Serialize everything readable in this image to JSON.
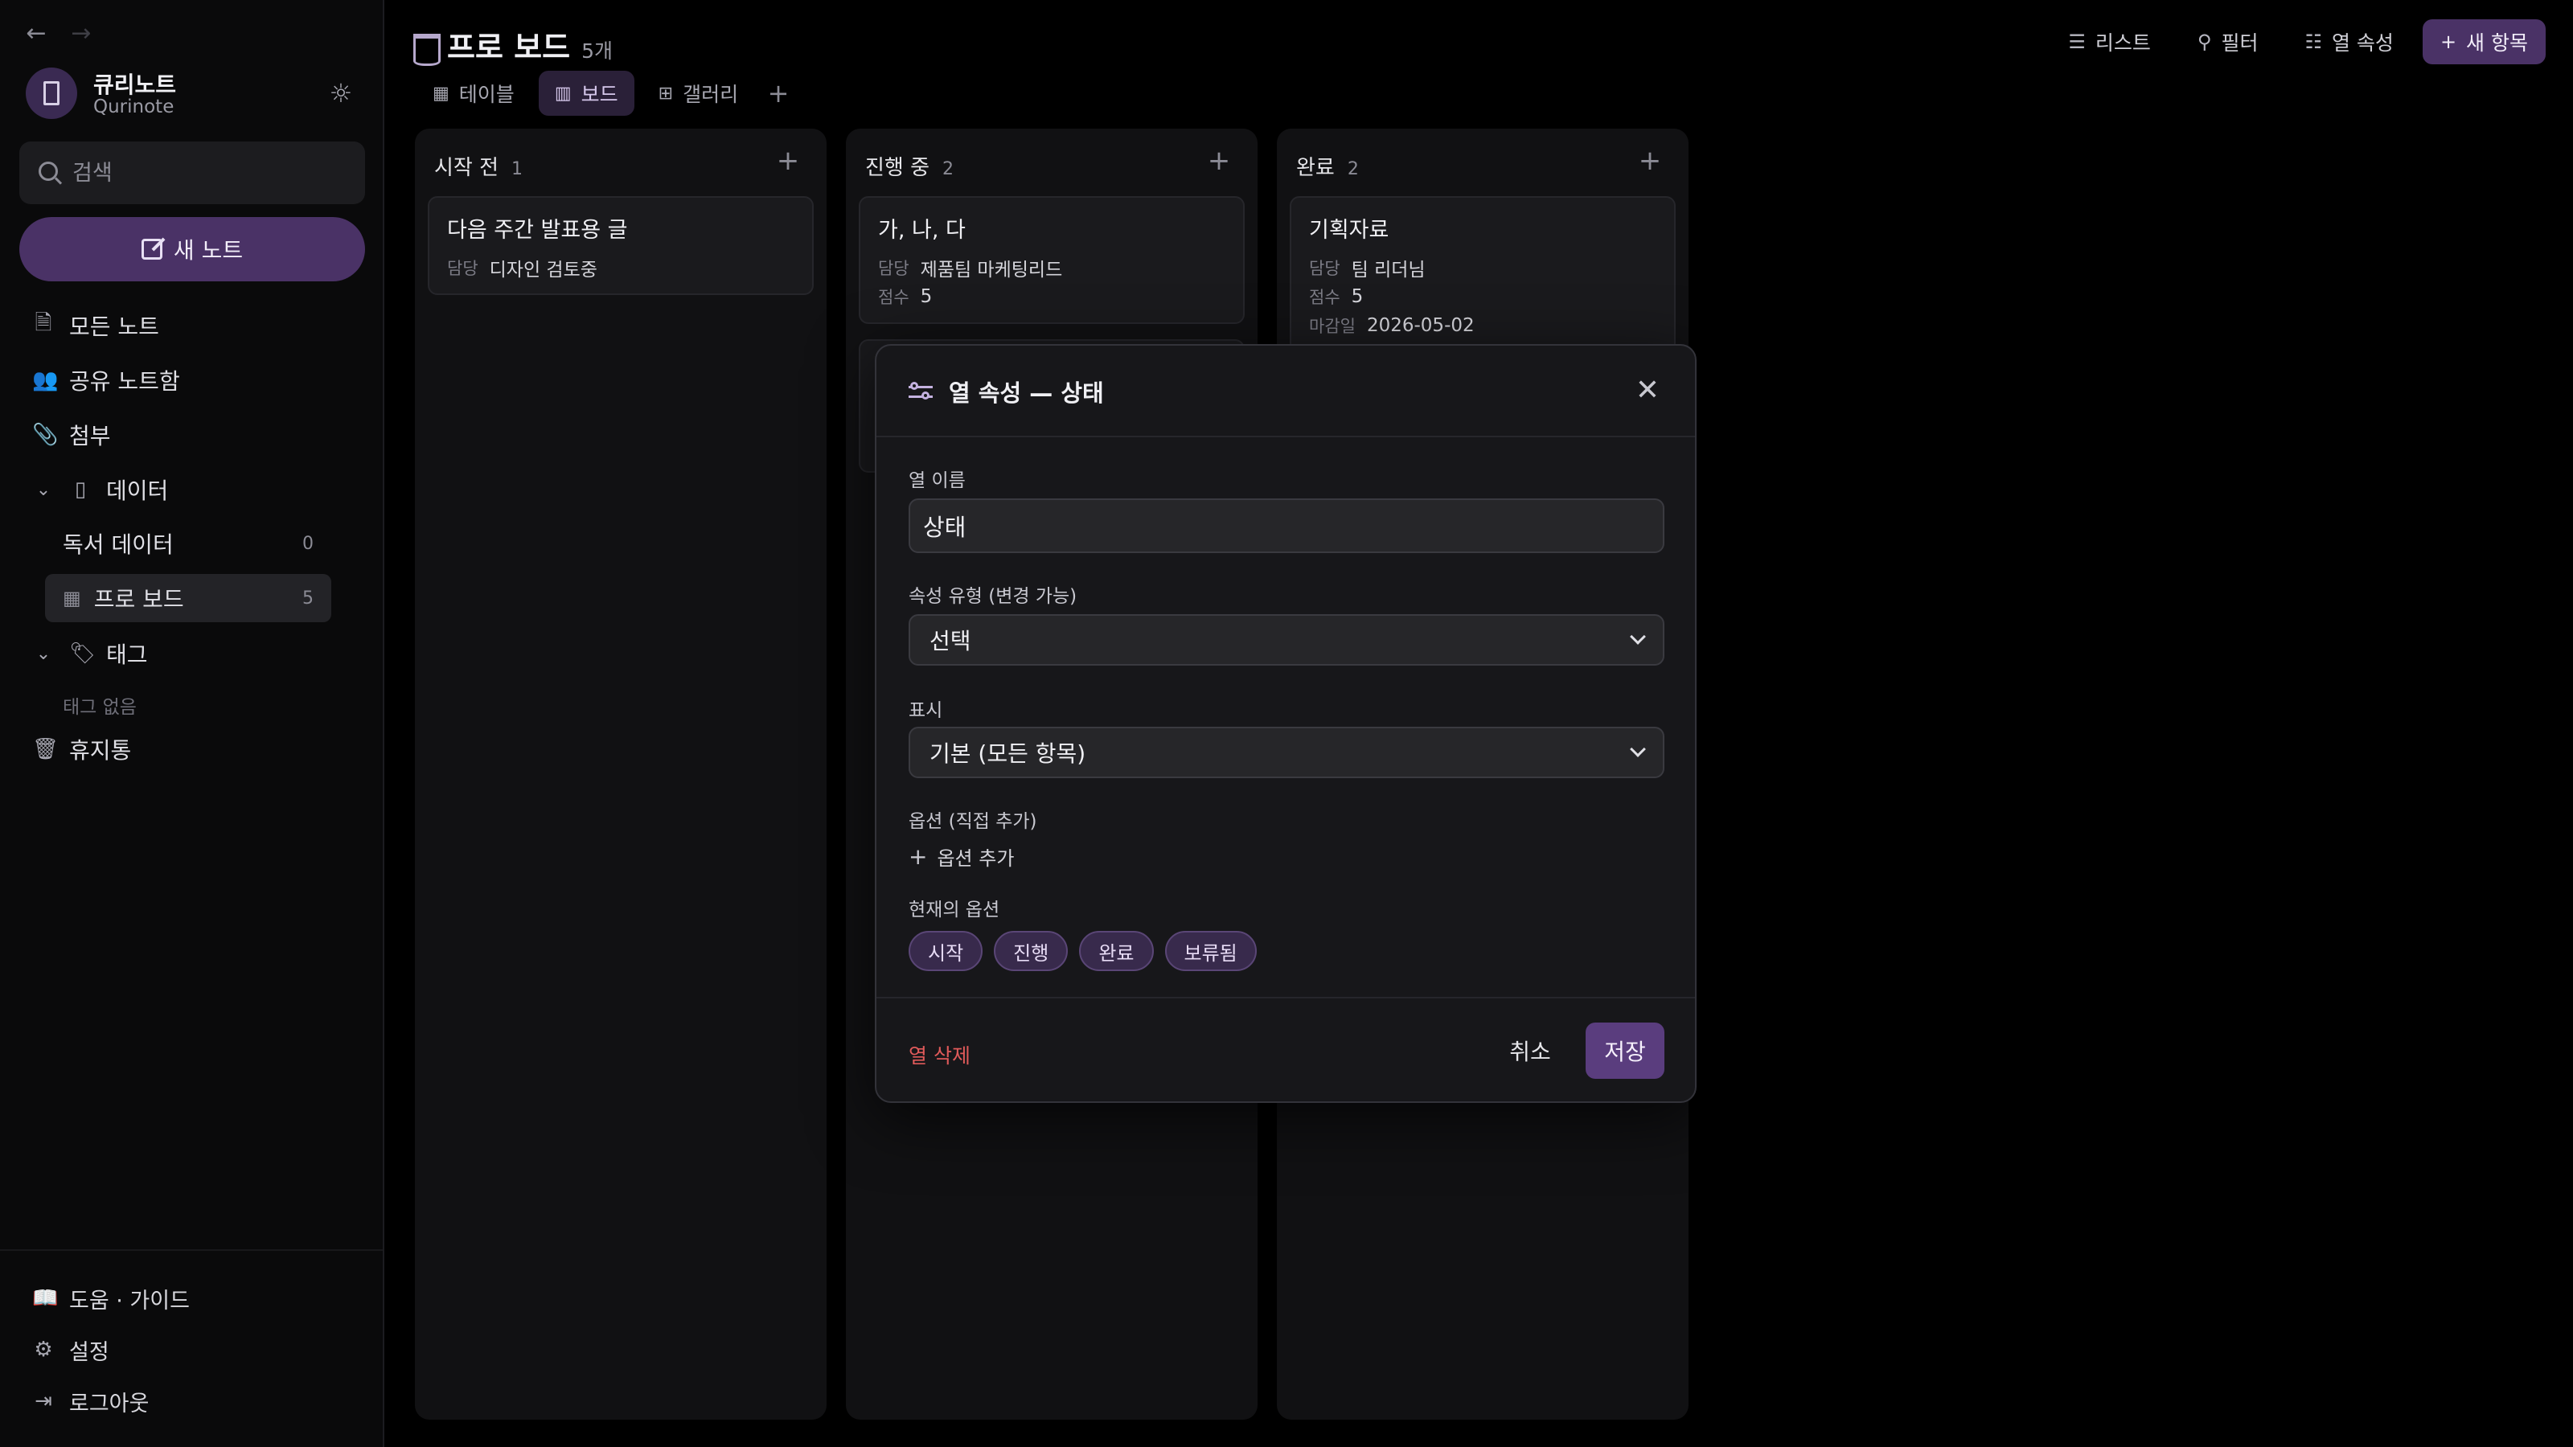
{
  "sidebar": {
    "workspace_name": "큐리노트",
    "workspace_sub": "Qurinote",
    "search_placeholder": "검색",
    "new_note_label": "새 노트",
    "nav": {
      "all_notes": "모든 노트",
      "shared": "공유 노트함",
      "attachments": "첨부",
      "databases": "데이터",
      "tags": "태그",
      "trash": "휴지통"
    },
    "db_items": [
      {
        "label": "독서 데이터",
        "count": "0"
      },
      {
        "label": "프로 보드",
        "count": "5"
      }
    ],
    "tags_empty": "태그 없음",
    "bottom": {
      "guide": "도움 · 가이드",
      "settings": "설정",
      "logout": "로그아웃"
    }
  },
  "header": {
    "title": "프로 보드",
    "count": "5개",
    "toolbar": {
      "list": "리스트",
      "filter": "필터",
      "properties": "열 속성",
      "new_row": "새 항목"
    }
  },
  "views": {
    "table": "테이블",
    "board": "보드",
    "gallery": "갤러리"
  },
  "columns": [
    {
      "title": "시작 전",
      "count": "1",
      "cards": [
        {
          "title": "다음 주간 발표용 글",
          "fields": [
            {
              "k": "담당",
              "v": "디자인 검토중"
            }
          ]
        }
      ]
    },
    {
      "title": "진행 중",
      "count": "2",
      "cards": [
        {
          "title": "가, 나, 다",
          "fields": [
            {
              "k": "담당",
              "v": "제품팀 마케팅리드"
            },
            {
              "k": "점수",
              "v": "5"
            }
          ]
        }
      ]
    },
    {
      "title": "완료",
      "count": "2",
      "cards": [
        {
          "title": "기획자료",
          "fields": [
            {
              "k": "담당",
              "v": "팀 리더님"
            },
            {
              "k": "점수",
              "v": "5"
            },
            {
              "k": "마감일",
              "v": "2026-05-02"
            }
          ]
        }
      ]
    }
  ],
  "modal": {
    "title": "열 속성 — 상태",
    "name_label": "열 이름",
    "name_value": "상태",
    "type_label": "속성 유형 (변경 가능)",
    "type_value": "선택",
    "format_label": "표시",
    "format_value": "기본 (모든 항목)",
    "options_label": "옵션 (직접 추가)",
    "add_option": "옵션 추가",
    "existing_label": "현재의 옵션",
    "chips": [
      "시작",
      "진행",
      "완료",
      "보류됨"
    ],
    "delete": "열 삭제",
    "cancel": "취소",
    "confirm": "저장"
  }
}
